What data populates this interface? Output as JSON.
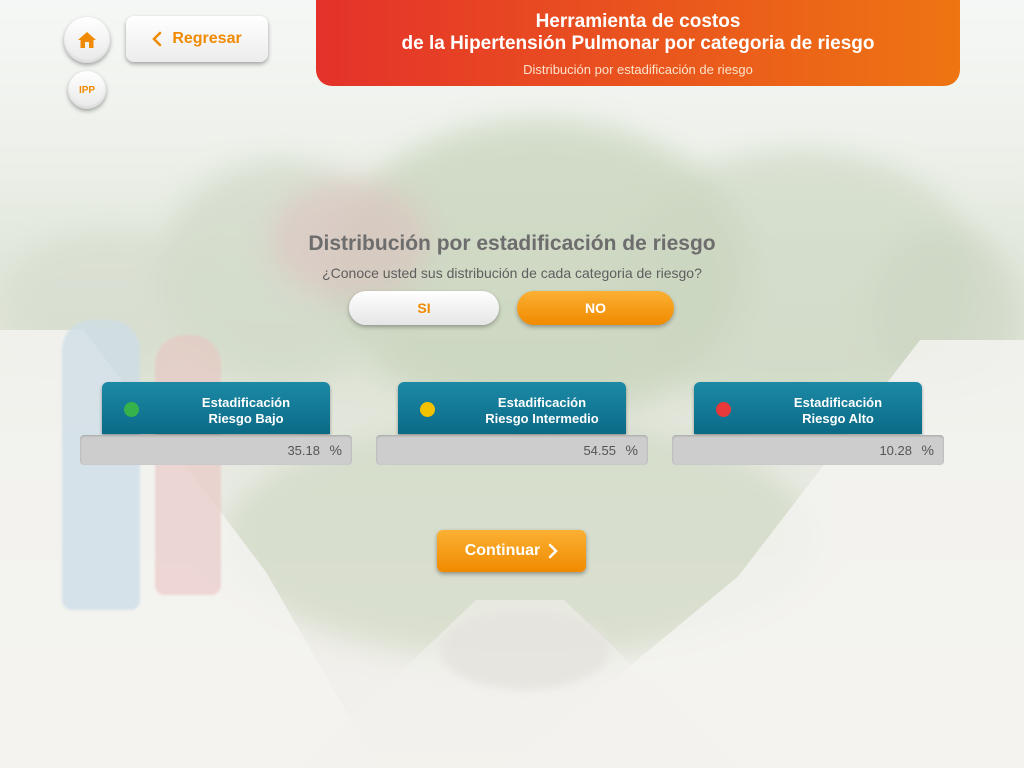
{
  "colors": {
    "accent": "#f08a00",
    "header_start": "#e4322b",
    "header_end": "#ee7512",
    "tab": "#0b6a86",
    "dot_low": "#35b34a",
    "dot_mid": "#f2c200",
    "dot_high": "#e7393a"
  },
  "nav": {
    "home_icon": "home-icon",
    "back_label": "Regresar",
    "ipp_label": "IPP"
  },
  "header": {
    "title_line1": "Herramienta de costos",
    "title_line2": "de la Hipertensión Pulmonar por categoria de riesgo",
    "subtitle": "Distribución por estadificación de riesgo"
  },
  "question": {
    "title": "Distribución por estadificación de riesgo",
    "text": "¿Conoce usted sus distribución de cada categoria de riesgo?",
    "yes_label": "SI",
    "no_label": "NO",
    "selected": "NO"
  },
  "categories": [
    {
      "line1": "Estadificación",
      "line2": "Riesgo Bajo",
      "value": "35.18",
      "unit": "%"
    },
    {
      "line1": "Estadificación",
      "line2": "Riesgo Intermedio",
      "value": "54.55",
      "unit": "%"
    },
    {
      "line1": "Estadificación",
      "line2": "Riesgo Alto",
      "value": "10.28",
      "unit": "%"
    }
  ],
  "continue_label": "Continuar"
}
